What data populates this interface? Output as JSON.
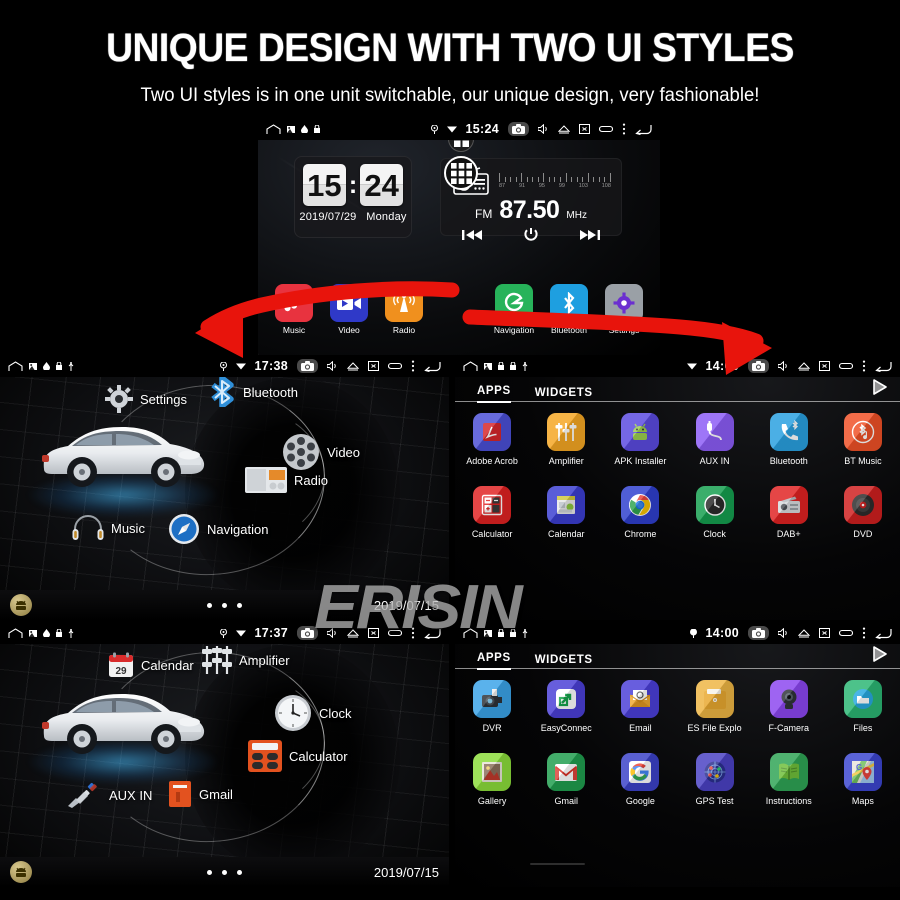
{
  "header": {
    "title": "UNIQUE DESIGN WITH TWO UI STYLES",
    "subtitle": "Two UI styles is in one unit switchable, our unique design, very fashionable!"
  },
  "watermark": {
    "text": "ERISIN"
  },
  "colors": {
    "accent_red": "#e8140c",
    "background": "#000000",
    "text": "#ffffff",
    "car_glow_blue": "#46beff"
  },
  "status_icons": {
    "home": "home-icon",
    "gallery": "gallery-icon",
    "drop": "drop-icon",
    "lock": "lock-icon",
    "usb": "usb-icon",
    "location": "location-pin-icon",
    "wifi": "wifi-icon",
    "camera": "camera-icon",
    "volume": "volume-icon",
    "eject": "eject-icon",
    "screenshot": "screenshot-icon",
    "recents": "recents-icon",
    "overflow": "overflow-menu-icon",
    "back": "back-arrow-icon"
  },
  "home_screen": {
    "status": {
      "time": "15:24"
    },
    "clock_widget": {
      "hours": "15",
      "minutes": "24",
      "separator": ":",
      "date": "2019/07/29",
      "weekday": "Monday"
    },
    "radio_widget": {
      "icon": "radio-icon",
      "band": "FM",
      "frequency": "87.50",
      "unit": "MHz",
      "scale_labels": [
        "87",
        "91",
        "95",
        "99",
        "103",
        "108"
      ],
      "controls": [
        "prev-track-button",
        "power-button",
        "next-track-button"
      ]
    },
    "dock": [
      {
        "label": "Music",
        "icon": "music-note-icon",
        "color": "#e8333f"
      },
      {
        "label": "Video",
        "icon": "video-camera-icon",
        "color": "#2f39c8"
      },
      {
        "label": "Radio",
        "icon": "radio-tower-icon",
        "color": "#f0901e"
      },
      {
        "label": "Navigation",
        "icon": "navigation-icon",
        "color": "#27b35a"
      },
      {
        "label": "Bluetooth",
        "icon": "bluetooth-icon",
        "color": "#1e9fe0"
      },
      {
        "label": "Settings",
        "icon": "gear-icon",
        "color": "#9aa0a6"
      }
    ],
    "app_drawer_buttons": [
      "apps-grid-button-small",
      "apps-grid-button-large"
    ]
  },
  "car_ui_top": {
    "status": {
      "time": "17:38"
    },
    "menu": [
      {
        "label": "Settings",
        "icon": "gear-icon"
      },
      {
        "label": "Bluetooth",
        "icon": "bluetooth-icon"
      },
      {
        "label": "Video",
        "icon": "film-reel-icon"
      },
      {
        "label": "Radio",
        "icon": "radio-set-icon"
      },
      {
        "label": "Navigation",
        "icon": "compass-icon"
      },
      {
        "label": "Music",
        "icon": "headphones-icon"
      }
    ],
    "footer": {
      "droid_button": "android-home-button",
      "date": "2019/07/15",
      "page_dots": 3
    }
  },
  "car_ui_bottom": {
    "status": {
      "time": "17:37"
    },
    "menu": [
      {
        "label": "Calendar",
        "icon": "calendar-icon"
      },
      {
        "label": "Amplifier",
        "icon": "equalizer-icon"
      },
      {
        "label": "Clock",
        "icon": "analog-clock-icon"
      },
      {
        "label": "Calculator",
        "icon": "calculator-icon"
      },
      {
        "label": "Gmail",
        "icon": "gmail-icon"
      },
      {
        "label": "AUX IN",
        "icon": "aux-jack-icon"
      }
    ],
    "footer": {
      "droid_button": "android-home-button",
      "date": "2019/07/15",
      "page_dots": 3
    }
  },
  "drawer_top": {
    "status": {
      "time": "14:00"
    },
    "tabs": [
      {
        "label": "APPS",
        "active": true
      },
      {
        "label": "WIDGETS",
        "active": false
      }
    ],
    "play_store_icon": "play-store-icon",
    "apps": [
      {
        "label": "Adobe Acrob",
        "icon": "adobe-acrobat-icon",
        "color": "#4b4fd6"
      },
      {
        "label": "Amplifier",
        "icon": "equalizer-icon",
        "color": "#f5a623"
      },
      {
        "label": "APK Installer",
        "icon": "android-icon",
        "color": "#5b4ae0"
      },
      {
        "label": "AUX IN",
        "icon": "aux-jack-icon",
        "color": "#8b5cf6"
      },
      {
        "label": "Bluetooth",
        "icon": "bt-phone-icon",
        "color": "#29a0e0"
      },
      {
        "label": "BT Music",
        "icon": "bt-music-icon",
        "color": "#ef5026"
      },
      {
        "label": "Calculator",
        "icon": "calculator-icon",
        "color": "#e02222"
      },
      {
        "label": "Calendar",
        "icon": "calendar-icon",
        "color": "#3b3ed0"
      },
      {
        "label": "Chrome",
        "icon": "chrome-icon",
        "color": "#2f3fce"
      },
      {
        "label": "Clock",
        "icon": "analog-clock-icon",
        "color": "#159e4f"
      },
      {
        "label": "DAB+",
        "icon": "dab-radio-icon",
        "color": "#e02222"
      },
      {
        "label": "DVD",
        "icon": "dvd-disc-icon",
        "color": "#cf1f1f"
      }
    ]
  },
  "drawer_bottom": {
    "status": {
      "time": "14:00"
    },
    "tabs": [
      {
        "label": "APPS",
        "active": true
      },
      {
        "label": "WIDGETS",
        "active": false
      }
    ],
    "play_store_icon": "play-store-icon",
    "apps": [
      {
        "label": "DVR",
        "icon": "dvr-camera-icon",
        "color": "#3aa3e8"
      },
      {
        "label": "EasyConnec",
        "icon": "easyconnect-icon",
        "color": "#4a3fd6"
      },
      {
        "label": "Email",
        "icon": "email-icon",
        "color": "#4b3fd8"
      },
      {
        "label": "ES File Explo",
        "icon": "folder-icon",
        "color": "#eeb544"
      },
      {
        "label": "F-Camera",
        "icon": "webcam-icon",
        "color": "#8b46f0"
      },
      {
        "label": "Files",
        "icon": "files-folder-icon",
        "color": "#2bb673"
      },
      {
        "label": "Gallery",
        "icon": "gallery-photo-icon",
        "color": "#8bdc3a"
      },
      {
        "label": "Gmail",
        "icon": "gmail-icon",
        "color": "#1f9d4e"
      },
      {
        "label": "Google",
        "icon": "google-g-icon",
        "color": "#3b41c8"
      },
      {
        "label": "GPS Test",
        "icon": "gps-test-icon",
        "color": "#4a41c4"
      },
      {
        "label": "Instructions",
        "icon": "book-icon",
        "color": "#2fa455"
      },
      {
        "label": "Maps",
        "icon": "maps-icon",
        "color": "#3b45cf"
      }
    ]
  }
}
